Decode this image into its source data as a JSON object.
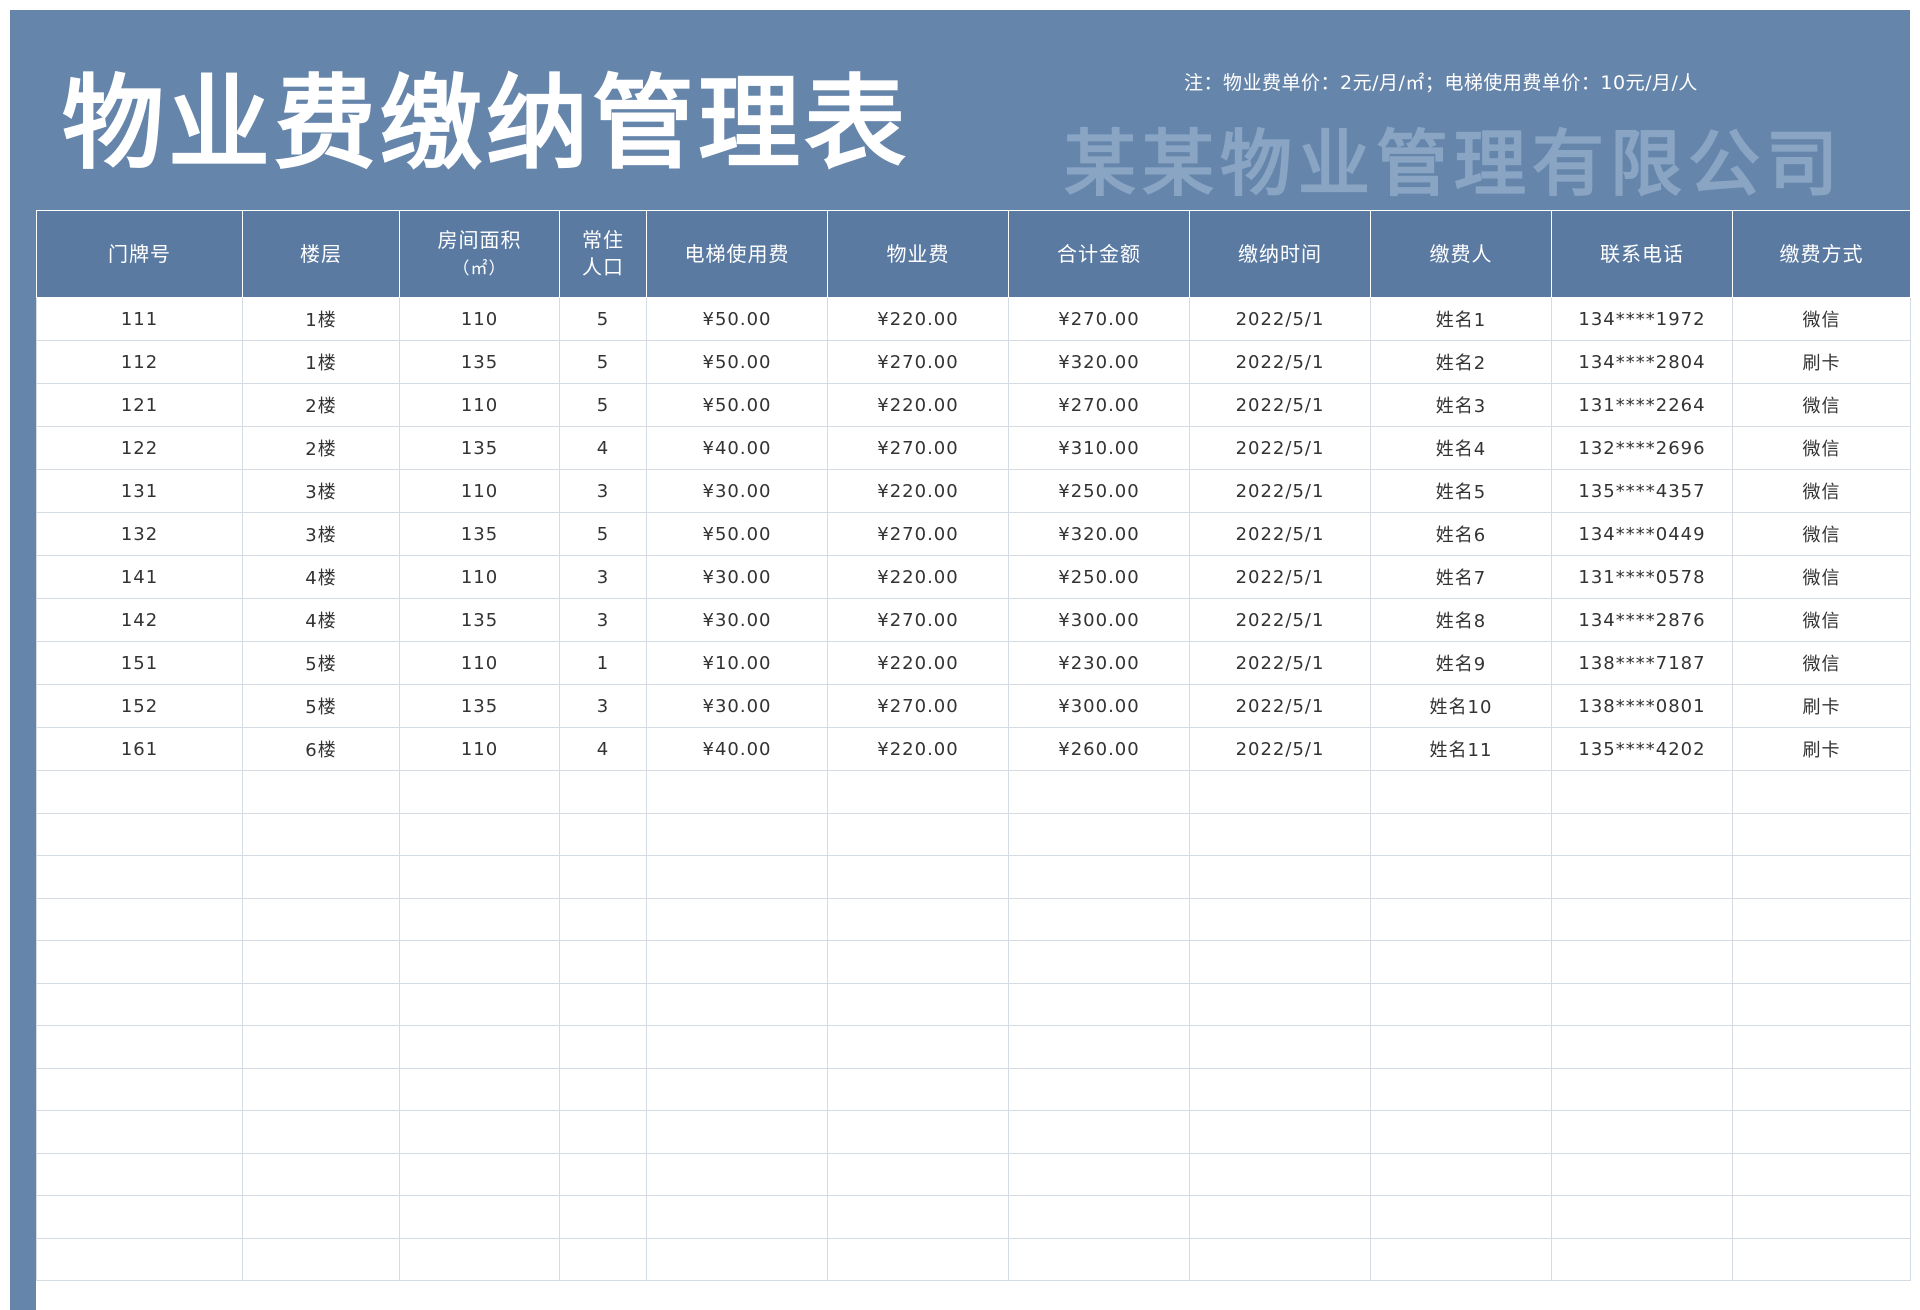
{
  "title": "物业费缴纳管理表",
  "note": "注：物业费单价：2元/月/㎡；电梯使用费单价：10元/月/人",
  "company": "某某物业管理有限公司",
  "columns": [
    {
      "line1": "门牌号",
      "line2": ""
    },
    {
      "line1": "楼层",
      "line2": ""
    },
    {
      "line1": "房间面积",
      "line2": "（㎡）"
    },
    {
      "line1": "常住",
      "line2": "人口"
    },
    {
      "line1": "电梯使用费",
      "line2": ""
    },
    {
      "line1": "物业费",
      "line2": ""
    },
    {
      "line1": "合计金额",
      "line2": ""
    },
    {
      "line1": "缴纳时间",
      "line2": ""
    },
    {
      "line1": "缴费人",
      "line2": ""
    },
    {
      "line1": "联系电话",
      "line2": ""
    },
    {
      "line1": "缴费方式",
      "line2": ""
    }
  ],
  "rows": [
    [
      "111",
      "1楼",
      "110",
      "5",
      "¥50.00",
      "¥220.00",
      "¥270.00",
      "2022/5/1",
      "姓名1",
      "134****1972",
      "微信"
    ],
    [
      "112",
      "1楼",
      "135",
      "5",
      "¥50.00",
      "¥270.00",
      "¥320.00",
      "2022/5/1",
      "姓名2",
      "134****2804",
      "刷卡"
    ],
    [
      "121",
      "2楼",
      "110",
      "5",
      "¥50.00",
      "¥220.00",
      "¥270.00",
      "2022/5/1",
      "姓名3",
      "131****2264",
      "微信"
    ],
    [
      "122",
      "2楼",
      "135",
      "4",
      "¥40.00",
      "¥270.00",
      "¥310.00",
      "2022/5/1",
      "姓名4",
      "132****2696",
      "微信"
    ],
    [
      "131",
      "3楼",
      "110",
      "3",
      "¥30.00",
      "¥220.00",
      "¥250.00",
      "2022/5/1",
      "姓名5",
      "135****4357",
      "微信"
    ],
    [
      "132",
      "3楼",
      "135",
      "5",
      "¥50.00",
      "¥270.00",
      "¥320.00",
      "2022/5/1",
      "姓名6",
      "134****0449",
      "微信"
    ],
    [
      "141",
      "4楼",
      "110",
      "3",
      "¥30.00",
      "¥220.00",
      "¥250.00",
      "2022/5/1",
      "姓名7",
      "131****0578",
      "微信"
    ],
    [
      "142",
      "4楼",
      "135",
      "3",
      "¥30.00",
      "¥270.00",
      "¥300.00",
      "2022/5/1",
      "姓名8",
      "134****2876",
      "微信"
    ],
    [
      "151",
      "5楼",
      "110",
      "1",
      "¥10.00",
      "¥220.00",
      "¥230.00",
      "2022/5/1",
      "姓名9",
      "138****7187",
      "微信"
    ],
    [
      "152",
      "5楼",
      "135",
      "3",
      "¥30.00",
      "¥270.00",
      "¥300.00",
      "2022/5/1",
      "姓名10",
      "138****0801",
      "刷卡"
    ],
    [
      "161",
      "6楼",
      "110",
      "4",
      "¥40.00",
      "¥220.00",
      "¥260.00",
      "2022/5/1",
      "姓名11",
      "135****4202",
      "刷卡"
    ]
  ],
  "empty_rows": 12
}
